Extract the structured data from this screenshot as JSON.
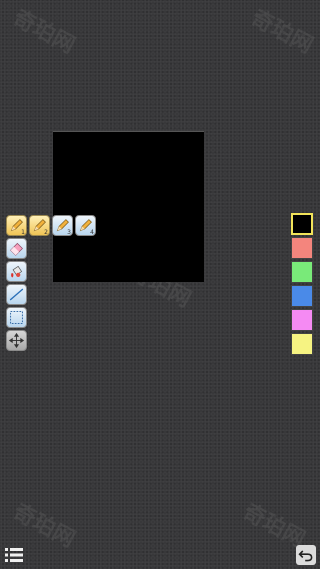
{
  "watermark_text": "奇珀网",
  "toolbar": {
    "pens": [
      {
        "id": "pen-1",
        "icon": "pencil-icon",
        "number": "1",
        "active": true
      },
      {
        "id": "pen-2",
        "icon": "pencil-icon",
        "number": "2",
        "active": true
      },
      {
        "id": "pen-3",
        "icon": "pencil-icon",
        "number": "3",
        "active": false
      },
      {
        "id": "pen-4",
        "icon": "pencil-icon",
        "number": "4",
        "active": false
      }
    ],
    "tools": [
      {
        "id": "eraser",
        "icon": "eraser-icon"
      },
      {
        "id": "fill",
        "icon": "paint-bucket-icon"
      },
      {
        "id": "line",
        "icon": "line-icon"
      },
      {
        "id": "select",
        "icon": "selection-icon"
      },
      {
        "id": "move",
        "icon": "move-icon"
      }
    ]
  },
  "palette": {
    "selected": 0,
    "colors": [
      "#000000",
      "#f4857d",
      "#79ea79",
      "#4a8ae8",
      "#f58af3",
      "#f6f382"
    ]
  },
  "bottom_bar": {
    "menu_icon": "menu-list-icon",
    "undo_icon": "undo-icon"
  }
}
